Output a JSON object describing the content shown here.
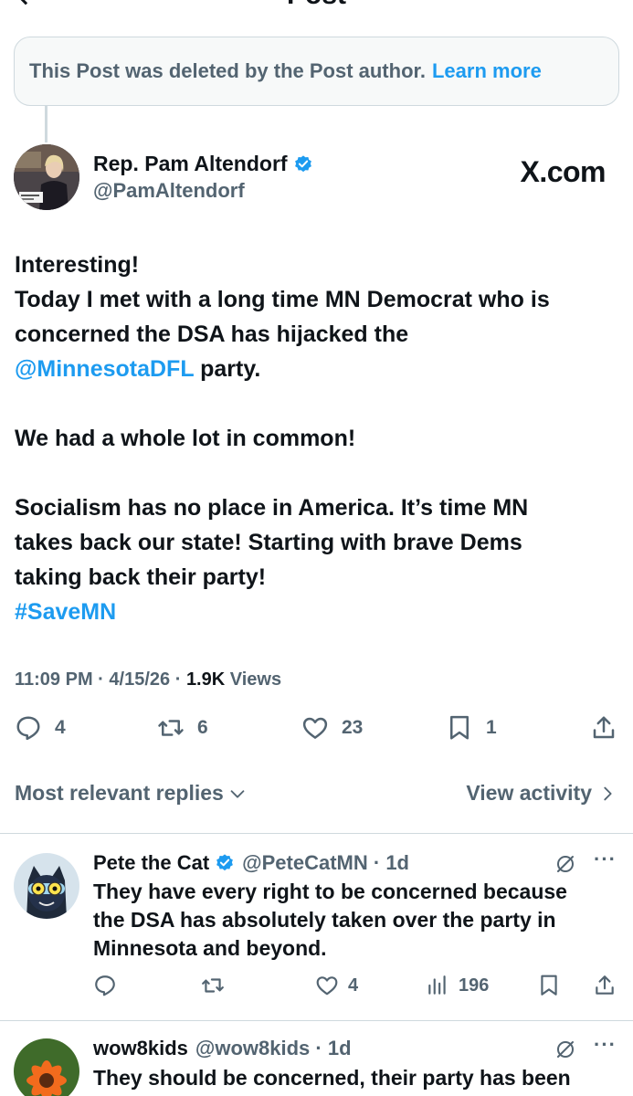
{
  "header": {
    "title": "Post"
  },
  "deleted_notice": {
    "text": "This Post was deleted by the Post author.",
    "link": "Learn more"
  },
  "post": {
    "author_name": "Rep. Pam Altendorf",
    "handle": "@PamAltendorf",
    "source_logo": "X.com",
    "body_lines": [
      "Interesting!",
      "Today I met with a long time MN Democrat who is",
      "concerned the DSA has hijacked the",
      "",
      "",
      "We had a whole lot in common!",
      "",
      "Socialism has no place in America. It’s time MN",
      "takes back our state! Starting with brave Dems",
      "taking back their party!"
    ],
    "mention": "@MinnesotaDFL",
    "mention_suffix": " party.",
    "hashtag": "#SaveMN",
    "time": "11:09 PM",
    "date": "4/15/26",
    "views_count": "1.9K",
    "views_label": "Views",
    "replies": "4",
    "reposts": "6",
    "likes": "23",
    "bookmarks": "1"
  },
  "sort": {
    "left_label": "Most relevant replies",
    "right_label": "View activity"
  },
  "replies": [
    {
      "name": "Pete the Cat",
      "handle": "@PeteCatMN",
      "time": "1d",
      "text_lines": [
        "They have every right to be concerned because",
        "the DSA has absolutely taken over the party in",
        "Minnesota and beyond."
      ],
      "likes": "4",
      "views": "196"
    },
    {
      "name": "wow8kids",
      "handle": "@wow8kids",
      "time": "1d",
      "text_lines": [
        "They should be concerned, their party has been"
      ]
    }
  ],
  "colors": {
    "accent": "#1d9bf0",
    "text": "#0f1419",
    "muted": "#536471",
    "border": "#cfd9de"
  },
  "icons": [
    "back-icon",
    "verified-icon",
    "reply-icon",
    "repost-icon",
    "like-icon",
    "bookmark-icon",
    "share-icon",
    "chevron-down-icon",
    "chevron-right-icon",
    "grok-icon",
    "more-icon",
    "views-icon"
  ]
}
